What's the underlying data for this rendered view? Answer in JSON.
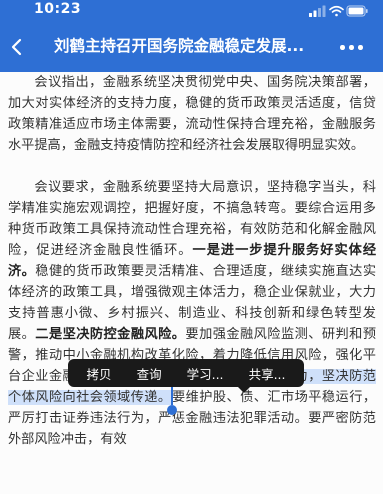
{
  "status_bar": {
    "time": "10:23"
  },
  "nav": {
    "title": "刘鹤主持召开国务院金融稳定发展..."
  },
  "article": {
    "p1": "会议指出，金融系统坚决贯彻党中央、国务院决策部署，加大对实体经济的支持力度，稳健的货币政策灵活适度，信贷政策精准适应市场主体需要，流动性保持合理充裕，金融服务水平提高，金融支持疫情防控和经济社会发展取得明显实效。",
    "p2_a": "会议要求，金融系统要坚持大局意识，坚持稳字当头，科学精准实施宏观调控，把握好度，不搞急转弯。要综合运用多种货币政策工具保持流动性合理充裕，有效防范和化解金融风险，促进经济金融良性循环。",
    "p2_bold1": "一是进一步提升服务好实体经济。",
    "p2_b": "稳健的货币政策要灵活精准、合理适度，继续实施直达实体经济的政策工具，增强微观主体活力，稳企业保就业，大力支持普惠小微、乡村振兴、制造业、科技创新和绿色转型发展。",
    "p2_bold2": "二是坚决防控金融风险。",
    "p2_c": "要加强金融风险监测、研判和预警，推动中小金融机构改革化险，着力降低信用风险，强化平台企业金融活动监管，",
    "p2_selected": "打击比特币挖矿和交易行为，坚决防范个体风险向社会领域传递。",
    "p2_d": "要维护股、债、汇市场平稳运行，严厉打击证券违法行为，严惩金融违法犯罪活动。要严密防范外部风险冲击，有效"
  },
  "context_menu": {
    "items": [
      "拷贝",
      "查询",
      "学习...",
      "共享..."
    ]
  }
}
